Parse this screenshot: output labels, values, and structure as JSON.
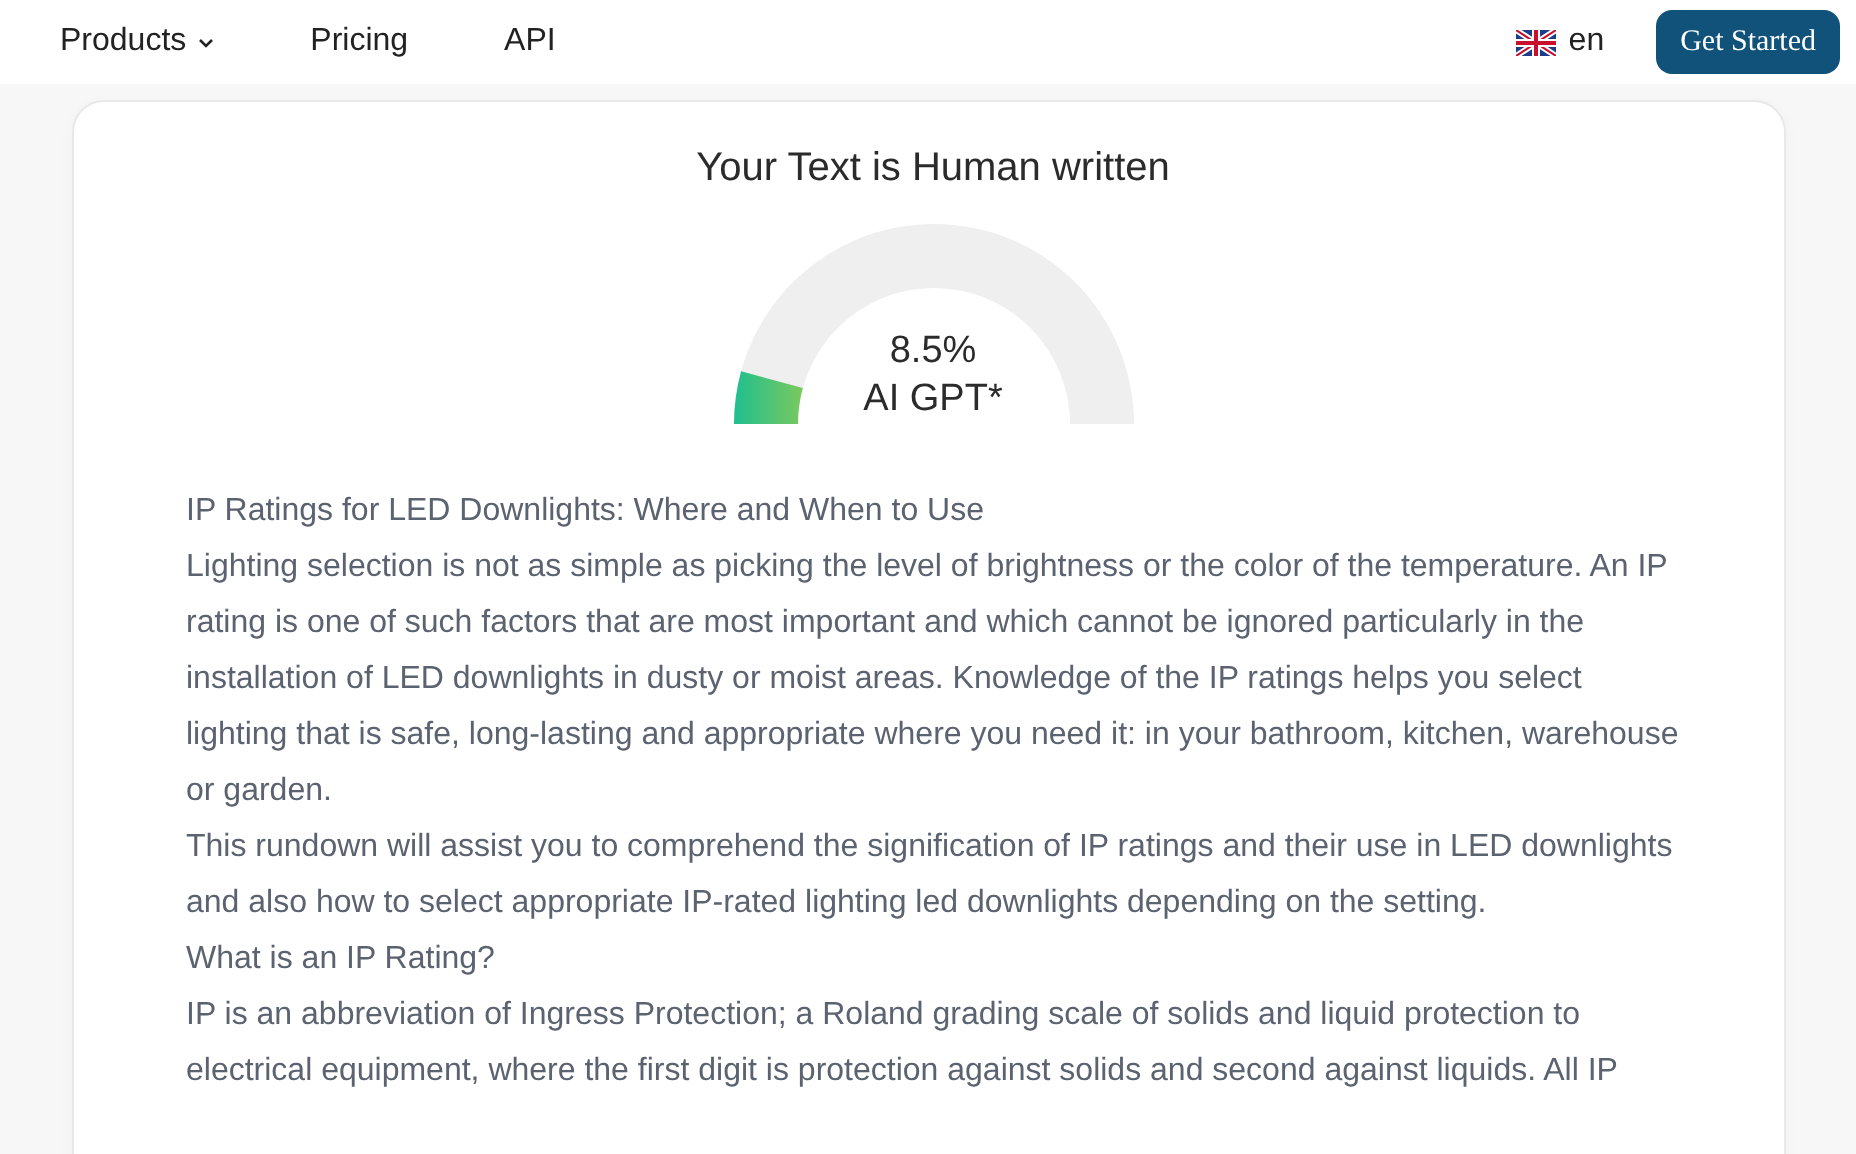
{
  "nav": {
    "links": [
      {
        "label": "Products",
        "dropdown": true
      },
      {
        "label": "Pricing",
        "dropdown": false
      },
      {
        "label": "API",
        "dropdown": false
      }
    ],
    "language": "en",
    "cta": "Get Started"
  },
  "result": {
    "title": "Your Text is Human written",
    "gauge": {
      "percent": "8.5%",
      "label": "AI GPT*"
    }
  },
  "text": [
    "IP Ratings for LED Downlights: Where and When to Use",
    "Lighting selection is not as simple as picking the level of brightness or the color of the temperature. An IP rating is one of such factors that are most important and which cannot be ignored particularly in the installation of LED downlights in dusty or moist areas. Knowledge of the IP ratings helps you select lighting that is safe, long-lasting and appropriate where you need it: in your bathroom, kitchen, warehouse or garden.",
    "This rundown will assist you to comprehend the signification of IP ratings and their use in LED downlights and also how to select appropriate IP-rated lighting led downlights depending on the setting.",
    "What is an IP Rating?",
    "IP is an abbreviation of Ingress Protection; a Roland grading scale of solids and liquid protection to electrical equipment, where the first digit is protection against solids and second against liquids. All IP"
  ]
}
